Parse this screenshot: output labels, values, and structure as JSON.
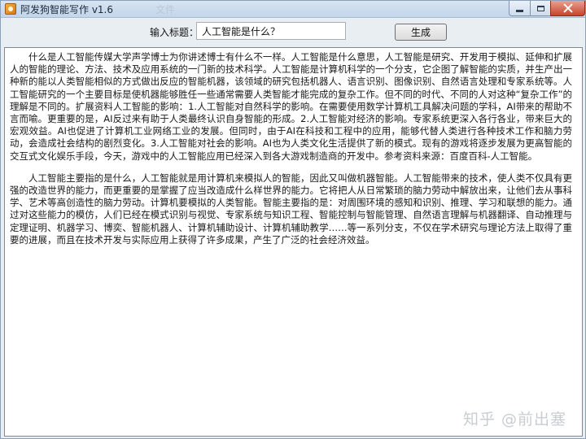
{
  "window": {
    "title": "阿发狗智能写作 v1.6",
    "ghost_title": "文件"
  },
  "form": {
    "title_label": "输入标题：",
    "title_input_value": "人工智能是什么？",
    "generate_button": "生成"
  },
  "content": {
    "paragraphs": [
      "什么是人工智能传媒大学声学博士为你讲述博士有什么不一样。人工智能是什么意思，人工智能是研究、开发用于模拟、延伸和扩展人的智能的理论、方法、技术及应用系统的一门新的技术科学。人工智能是计算机科学的一个分支，它企图了解智能的实质，并生产出一种新的能以人类智能相似的方式做出反应的智能机器，该领域的研究包括机器人、语言识别、图像识别、自然语言处理和专家系统等。人工智能研究的一个主要目标是使机器能够胜任一些通常需要人类智能才能完成的复杂工作。但不同的时代、不同的人对这种“复杂工作”的理解是不同的。扩展资料人工智能的影响：1.人工智能对自然科学的影响。在需要使用数学计算机工具解决问题的学科，AI带来的帮助不言而喻。更重要的是，AI反过来有助于人类最终认识自身智能的形成。2.人工智能对经济的影响。专家系统更深入各行各业，带来巨大的宏观效益。AI也促进了计算机工业网络工业的发展。但同时，由于AI在科技和工程中的应用，能够代替人类进行各种技术工作和脑力劳动，会造成社会结构的剧烈变化。3.人工智能对社会的影响。AI也为人类文化生活提供了新的模式。现有的游戏将逐步发展为更高智能的交互式文化娱乐手段，今天，游戏中的人工智能应用已经深入到各大游戏制造商的开发中。参考资料来源：百度百科-人工智能。",
      "人工智能主要指的是什么，人工智能就是用计算机来模拟人的智能，因此又叫做机器智能。人工智能带来的技术，使人类不仅具有更强的改造世界的能力，而更重要的是掌握了应当改造成什么样世界的能力。它将把人从日常繁琐的脑力劳动中解放出来，让他们去从事科学、艺术等高创造性的脑力劳动。计算机要模拟的人类智能。智能主要指的是：对周围环境的感知和识别、推理、学习和联想的能力。通过对这些能力的模仿，人们已经在模式识别与视觉、专家系统与知识工程、智能控制与智能管理、自然语言理解与机器翻译、自动推理与定理证明、机器学习、博奕、智能机器人、计算机辅助设计、计算机辅助教学……等一系列分支，不仅在学术研究与理论方法上取得了重要的进展，而且在技术开发与实际应用上获得了许多成果，产生了广泛的社会经济效益。"
    ]
  },
  "watermark": {
    "text": "知乎 @前出塞"
  }
}
